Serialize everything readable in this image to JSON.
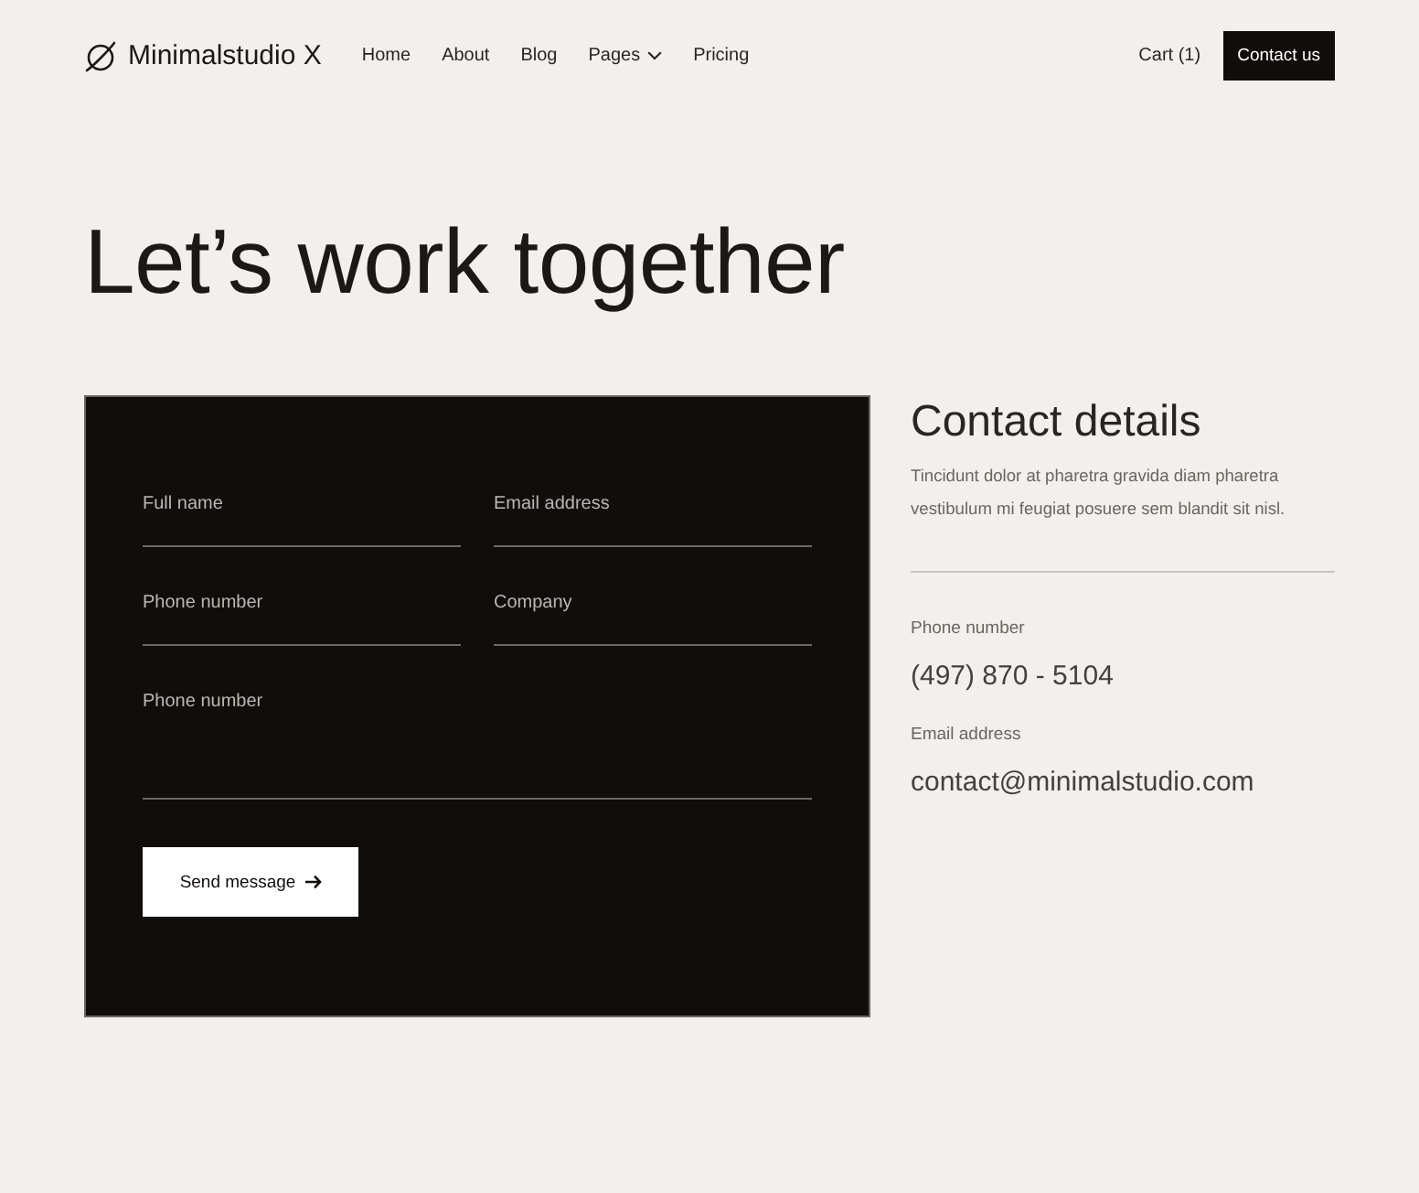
{
  "nav": {
    "logo": "Minimalstudio X",
    "links": [
      {
        "label": "Home",
        "dropdown": false
      },
      {
        "label": "About",
        "dropdown": false
      },
      {
        "label": "Blog",
        "dropdown": false
      },
      {
        "label": "Pages",
        "dropdown": true
      },
      {
        "label": "Pricing",
        "dropdown": false
      }
    ],
    "cart": "Cart (1)",
    "cta": "Contact us"
  },
  "heading": "Let’s work together",
  "form": {
    "fields": [
      {
        "kind": "input",
        "placeholder": "Full name"
      },
      {
        "kind": "input",
        "placeholder": "Email address"
      },
      {
        "kind": "input",
        "placeholder": "Phone number"
      },
      {
        "kind": "input",
        "placeholder": "Company"
      },
      {
        "kind": "textarea",
        "placeholder": "Phone number"
      }
    ],
    "submit": "Send message"
  },
  "details": {
    "title": "Contact details",
    "text": "Tincidunt dolor at pharetra gravida diam pharetra vestibulum mi feugiat posuere sem blandit sit nisl.",
    "items": [
      {
        "label": "Phone number",
        "value": "(497) 870 - 5104"
      },
      {
        "label": "Email address",
        "value": "contact@minimalstudio.com"
      }
    ]
  }
}
